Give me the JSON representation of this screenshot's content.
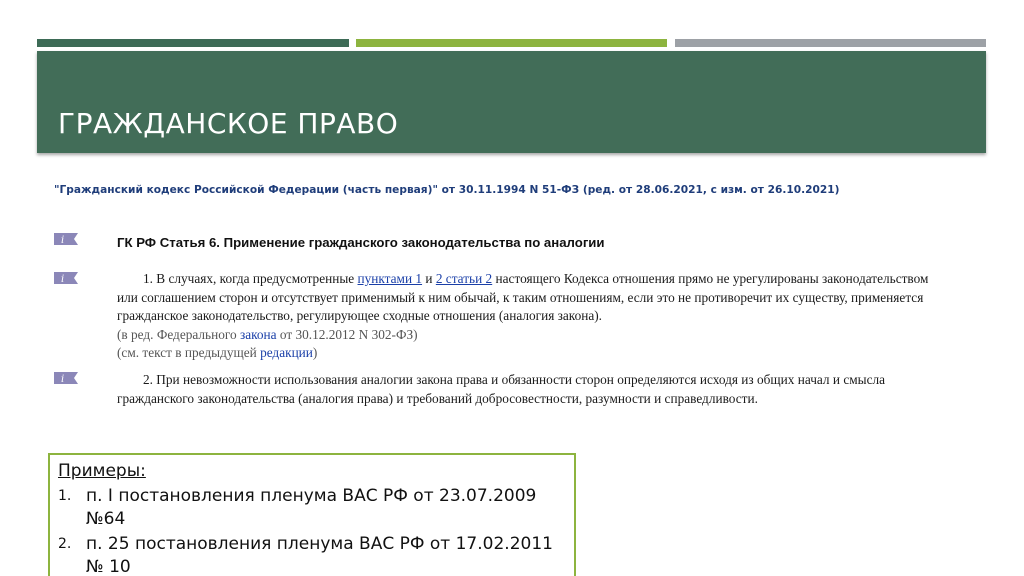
{
  "slide": {
    "title": "ГРАЖДАНСКОЕ ПРАВО",
    "colors": {
      "banner": "#426d58",
      "stripe1": "#3d6b56",
      "stripe2": "#8db43f",
      "stripe3": "#9da1a6",
      "link": "#1a3fa8"
    }
  },
  "source": {
    "text": "\"Гражданский кодекс Российской Федерации (часть первая)\" от 30.11.1994 N 51-ФЗ (ред. от 28.06.2021, с изм. от 26.10.2021)"
  },
  "article": {
    "heading": "ГК РФ Статья 6. Применение гражданского законодательства по аналогии",
    "icon": "info-flag-icon",
    "para1": {
      "pre": "1. В случаях, когда предусмотренные ",
      "link1": "пунктами 1",
      "mid": " и ",
      "link2": "2 статьи 2",
      "post": " настоящего Кодекса отношения прямо не урегулированы законодательством или соглашением сторон и отсутствует применимый к ним обычай, к таким отношениям, если это не противоречит их существу, применяется гражданское законодательство, регулирующее сходные отношения (аналогия закона).",
      "note1_pre": "(в ред. Федерального ",
      "note1_link": "закона",
      "note1_post": " от 30.12.2012 N 302-ФЗ)",
      "note2_pre": "(см. текст в предыдущей ",
      "note2_link": "редакции",
      "note2_post": ")"
    },
    "para2": {
      "text": "2. При невозможности использования аналогии закона права и обязанности сторон определяются исходя из общих начал и смысла гражданского законодательства (аналогия права) и требований добросовестности, разумности и справедливости."
    }
  },
  "examples": {
    "title": "Примеры:",
    "items": [
      {
        "num": "1.",
        "text": "п. I постановления пленума ВАС РФ от 23.07.2009 №64"
      },
      {
        "num": "2.",
        "text": "п. 25 постановления пленума ВАС РФ от 17.02.2011 № 10"
      }
    ]
  }
}
